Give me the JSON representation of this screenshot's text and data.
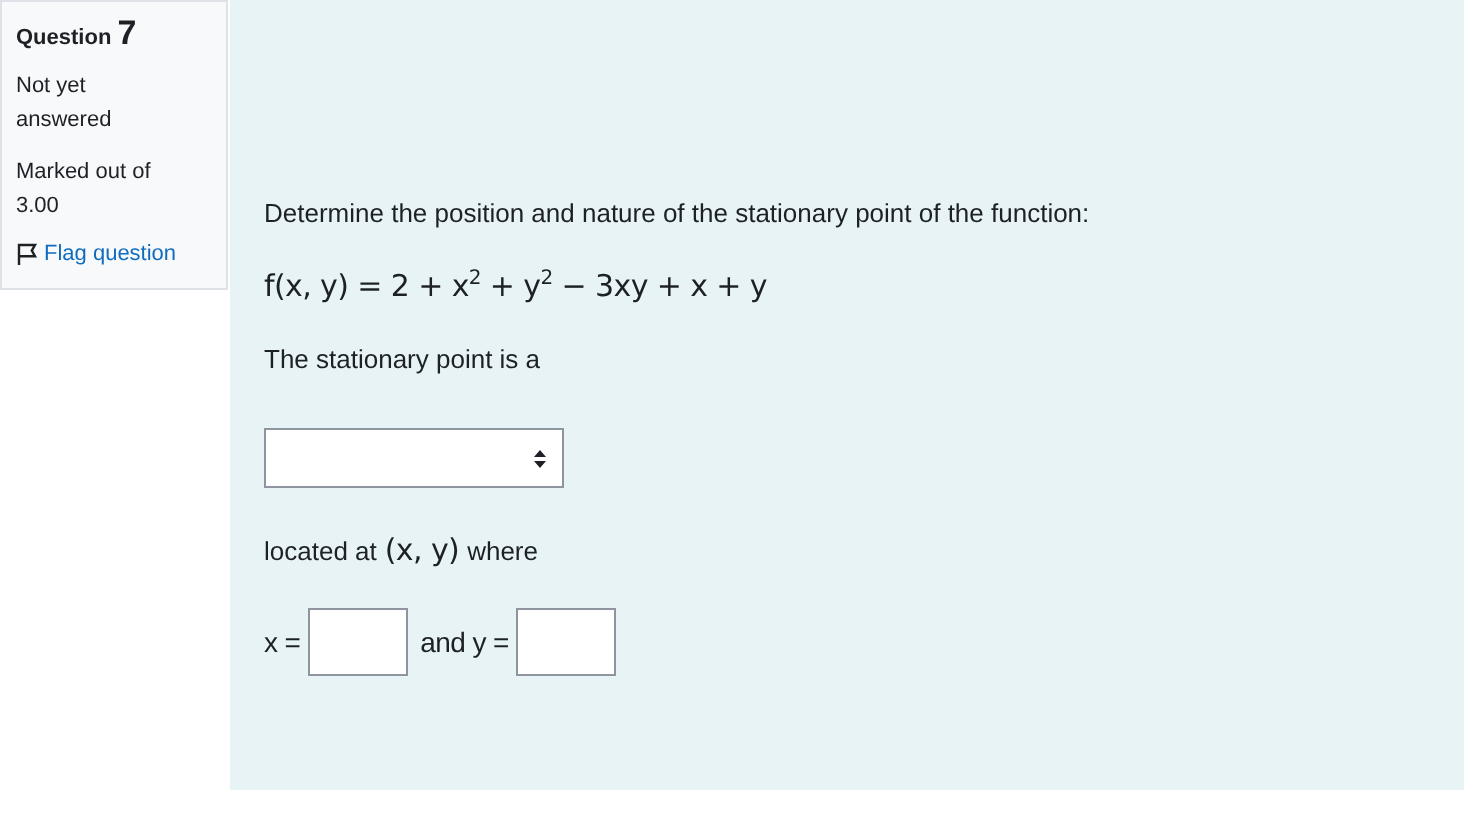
{
  "info": {
    "label": "Question",
    "number": "7",
    "status": "Not yet answered",
    "mark": "Marked out of 3.00",
    "flag": {
      "label": "Flag question",
      "flagged": false
    }
  },
  "question": {
    "prompt": "Determine the position and nature of the stationary point of the function:",
    "formula": "f(x, y) = 2 + x$^{2}$ + y$^{2}$ − 3xy + x + y",
    "intro": "The stationary point is a",
    "located": {
      "before": "located at",
      "math": "(x, y)",
      "after": "where"
    },
    "answers": [
      {
        "label": "x ="
      },
      {
        "label": "and y ="
      }
    ]
  }
}
